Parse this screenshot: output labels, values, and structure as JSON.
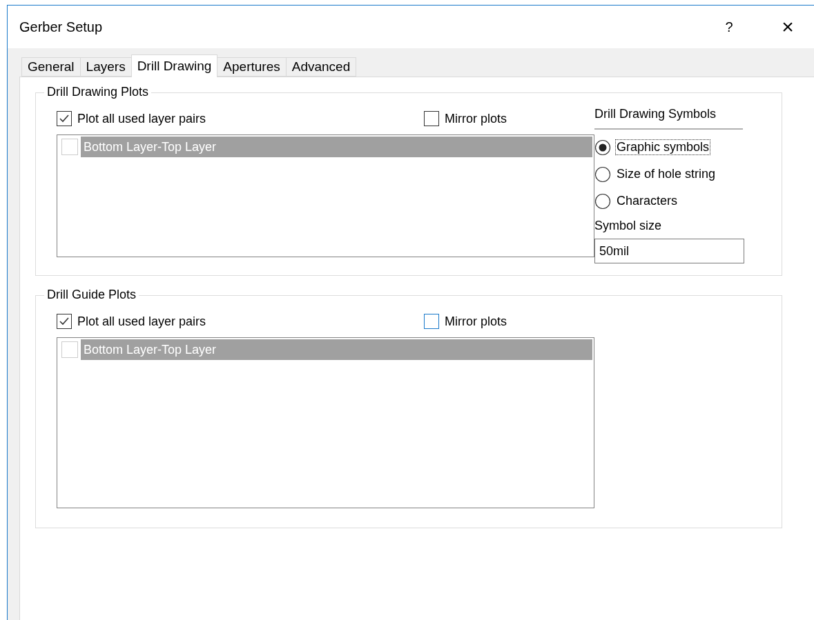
{
  "window": {
    "title": "Gerber Setup",
    "help": "?",
    "close": "×"
  },
  "tabs": [
    {
      "label": "General",
      "selected": false
    },
    {
      "label": "Layers",
      "selected": false
    },
    {
      "label": "Drill Drawing",
      "selected": true
    },
    {
      "label": "Apertures",
      "selected": false
    },
    {
      "label": "Advanced",
      "selected": false
    }
  ],
  "groups": [
    {
      "title": "Drill Drawing Plots",
      "plot_all": {
        "label": "Plot all used layer pairs",
        "checked": true,
        "focused": false
      },
      "mirror": {
        "label": "Mirror plots",
        "checked": false,
        "focused": false
      },
      "items": [
        {
          "label": "Bottom Layer-Top Layer",
          "checked": false,
          "selected": true
        }
      ]
    },
    {
      "title": "Drill Guide Plots",
      "plot_all": {
        "label": "Plot all used layer pairs",
        "checked": true,
        "focused": false
      },
      "mirror": {
        "label": "Mirror plots",
        "checked": false,
        "focused": true
      },
      "items": [
        {
          "label": "Bottom Layer-Top Layer",
          "checked": false,
          "selected": true
        }
      ]
    }
  ],
  "symbols": {
    "title": "Drill Drawing Symbols",
    "options": [
      {
        "label": "Graphic symbols",
        "selected": true
      },
      {
        "label": "Size of hole string",
        "selected": false
      },
      {
        "label": "Characters",
        "selected": false
      }
    ],
    "size_label": "Symbol size",
    "size_value": "50mil"
  }
}
